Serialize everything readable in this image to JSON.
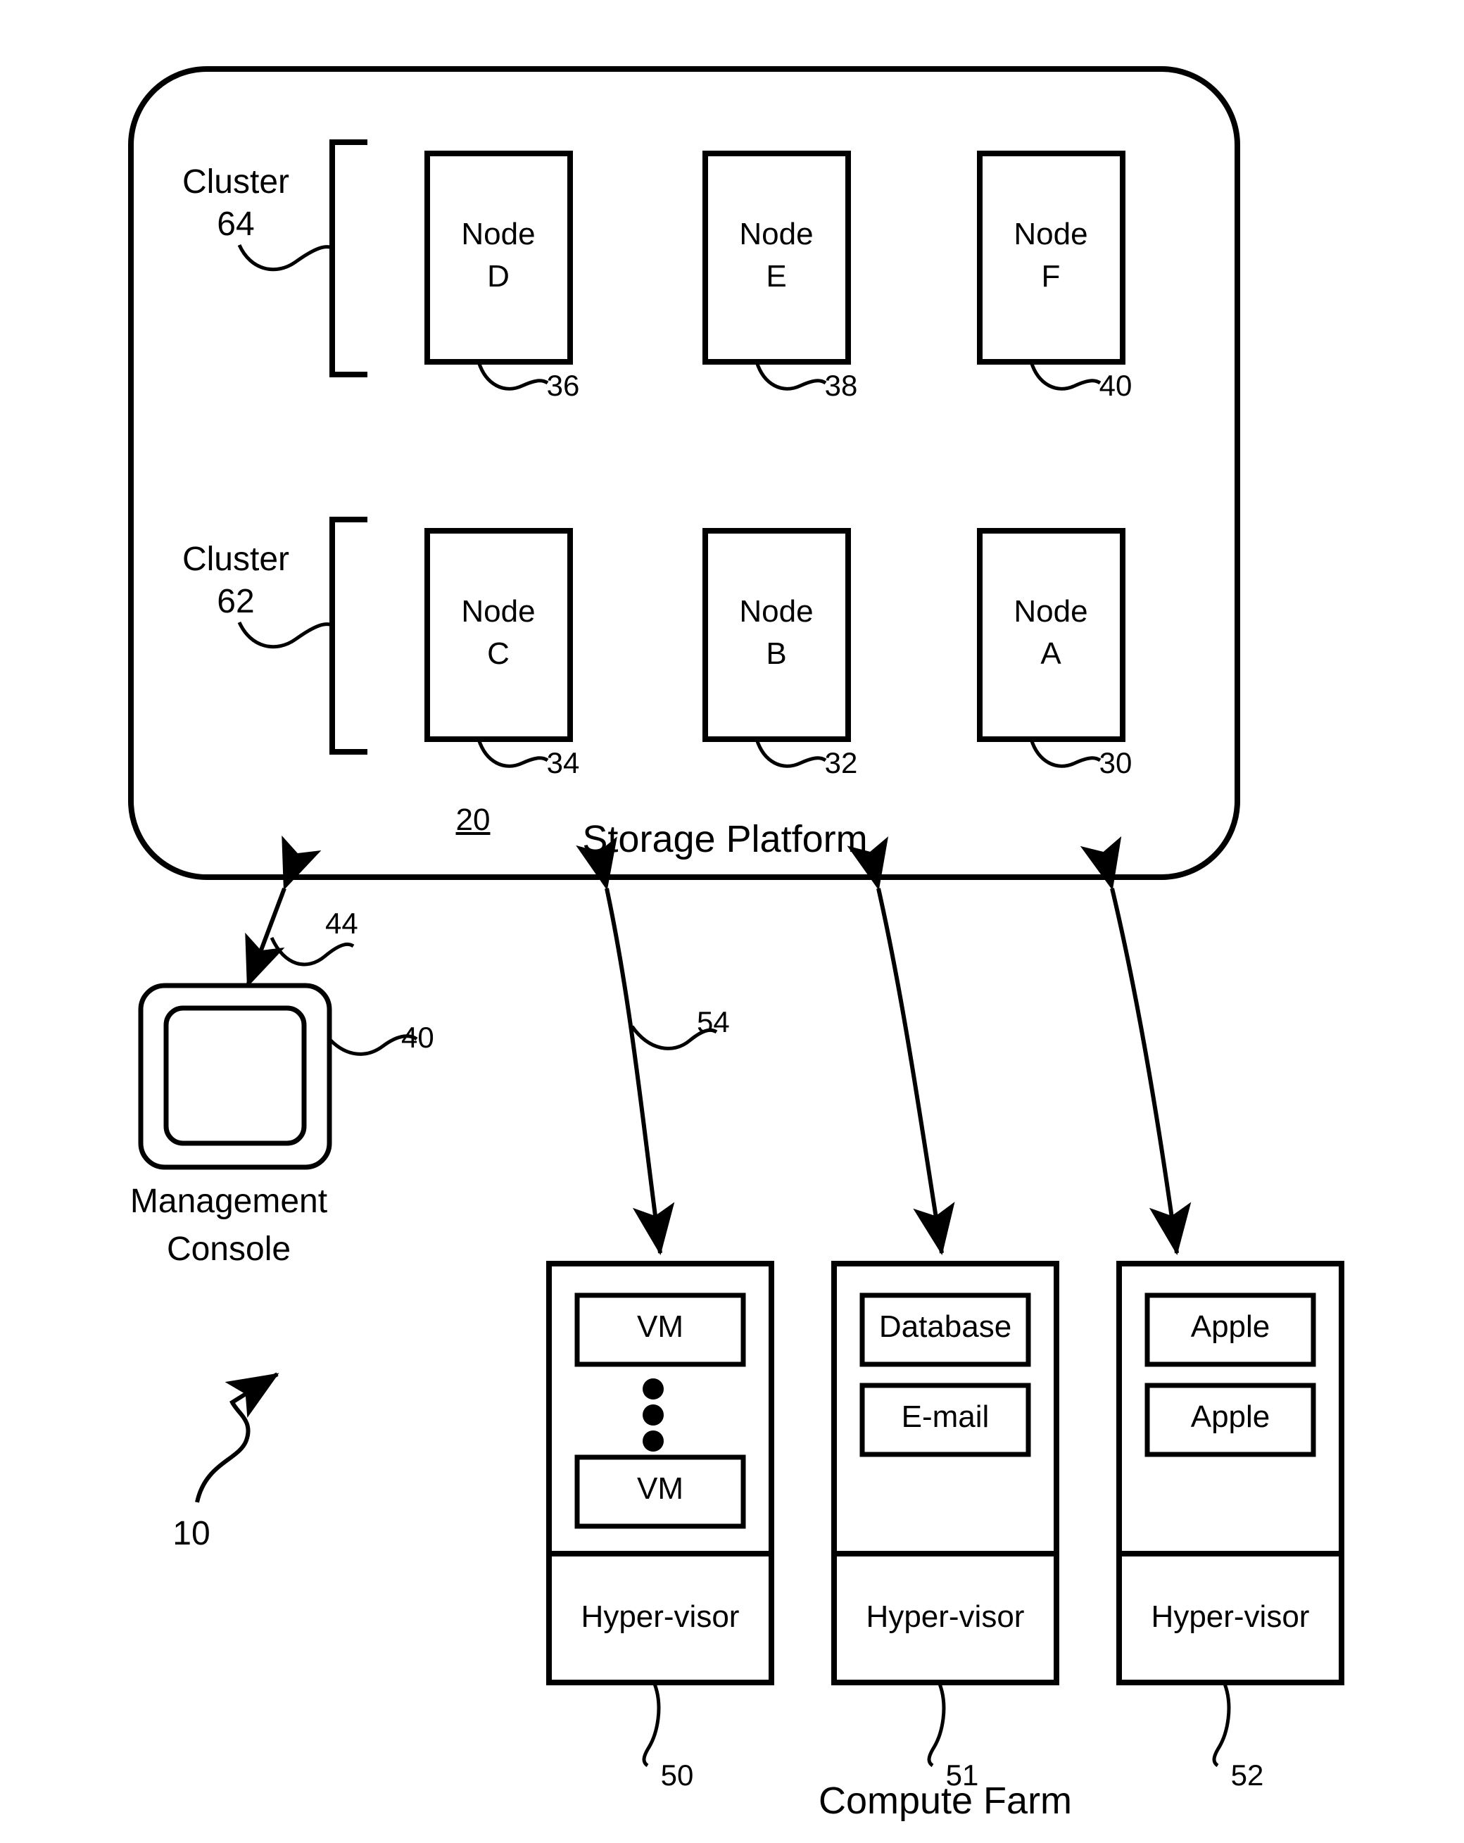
{
  "figure": {
    "reference_numeral": "10",
    "platform": {
      "label": "Storage Platform",
      "numeral": "20"
    },
    "clusters": [
      {
        "label": "Cluster",
        "numeral": "64"
      },
      {
        "label": "Cluster",
        "numeral": "62"
      }
    ],
    "nodes": [
      {
        "line1": "Node",
        "line2": "D",
        "numeral": "36"
      },
      {
        "line1": "Node",
        "line2": "E",
        "numeral": "38"
      },
      {
        "line1": "Node",
        "line2": "F",
        "numeral": "40"
      },
      {
        "line1": "Node",
        "line2": "C",
        "numeral": "34"
      },
      {
        "line1": "Node",
        "line2": "B",
        "numeral": "32"
      },
      {
        "line1": "Node",
        "line2": "A",
        "numeral": "30"
      }
    ],
    "management_console": {
      "line1": "Management",
      "line2": "Console",
      "numeral": "40",
      "link_numeral": "44"
    },
    "compute_farm": {
      "label": "Compute Farm",
      "link_numeral": "54",
      "servers": [
        {
          "numeral": "50",
          "hypervisor": "Hyper-visor",
          "workloads": [
            "VM",
            "VM"
          ],
          "ellipsis": "vertical-dots"
        },
        {
          "numeral": "51",
          "hypervisor": "Hyper-visor",
          "workloads": [
            "Database",
            "E-mail"
          ]
        },
        {
          "numeral": "52",
          "hypervisor": "Hyper-visor",
          "workloads": [
            "Apple",
            "Apple"
          ]
        }
      ]
    },
    "colors": {
      "ink": "#000000",
      "paper": "#ffffff"
    }
  }
}
